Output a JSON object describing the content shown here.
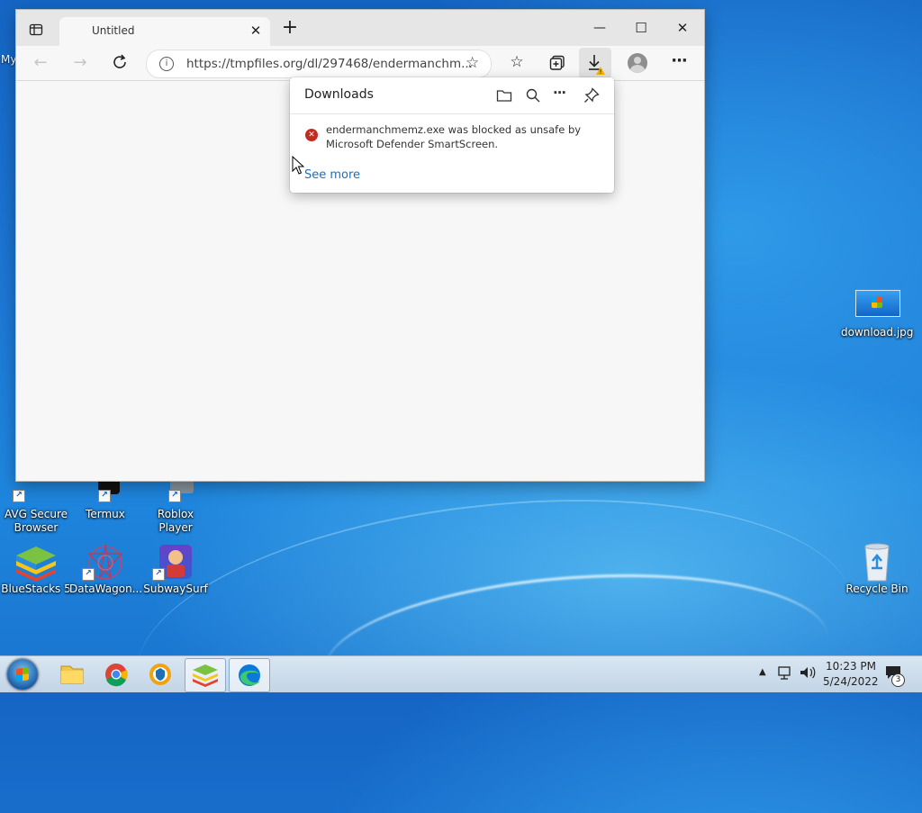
{
  "desktop": {
    "icons": [
      {
        "label": "AVG Secure Browser",
        "name": "avg-secure-browser-icon"
      },
      {
        "label": "Termux",
        "name": "termux-icon"
      },
      {
        "label": "Roblox Player",
        "name": "roblox-player-icon"
      },
      {
        "label": "BlueStacks 5",
        "name": "bluestacks-icon"
      },
      {
        "label": "DataWagon...",
        "name": "datawagon-icon"
      },
      {
        "label": "SubwaySurf",
        "name": "subwaysurf-icon"
      },
      {
        "label": "download.jpg",
        "name": "download-jpg-icon"
      },
      {
        "label": "Recycle Bin",
        "name": "recycle-bin-icon"
      }
    ],
    "partial_label": "My"
  },
  "browser": {
    "tab_title": "Untitled",
    "url": "https://tmpfiles.org/dl/297468/endermanchm...",
    "window_controls": {
      "minimize": "—",
      "maximize": "☐",
      "close": "✕"
    }
  },
  "downloads": {
    "title": "Downloads",
    "item_message": "endermanchmemz.exe was blocked as unsafe by Microsoft Defender SmartScreen.",
    "see_more": "See more"
  },
  "taskbar": {
    "time": "10:23 PM",
    "date": "5/24/2022",
    "notification_count": "3",
    "apps": [
      "start-orb-icon",
      "file-explorer-icon",
      "chrome-icon",
      "avg-browser-icon",
      "bluestacks-icon",
      "edge-icon"
    ]
  },
  "colors": {
    "accent": "#1f6fb5",
    "error": "#c42b1c",
    "warning": "#f2b600"
  }
}
